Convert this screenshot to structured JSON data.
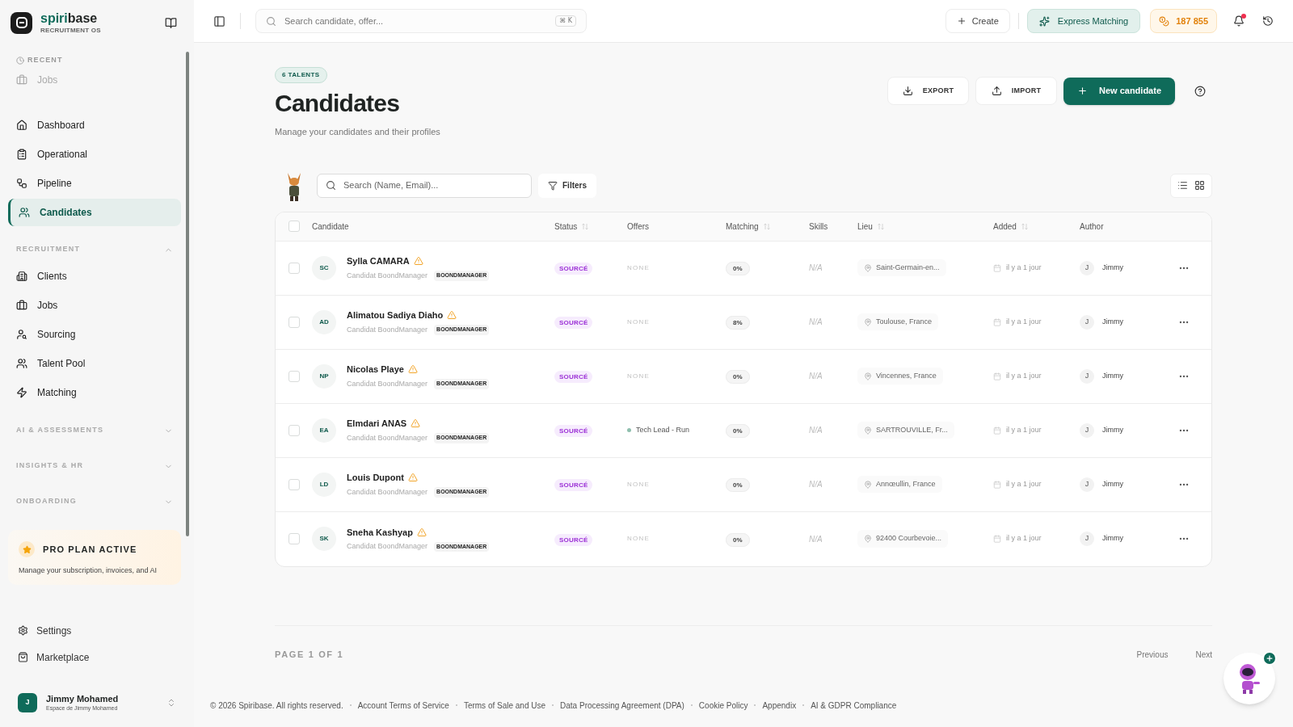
{
  "brand": {
    "name_accent": "spiri",
    "name": "base",
    "tagline": "RECRUITMENT OS"
  },
  "sidebar": {
    "recent": {
      "label": "RECENT",
      "items": [
        {
          "label": "Jobs"
        }
      ]
    },
    "nav": [
      {
        "label": "Dashboard",
        "selected": false
      },
      {
        "label": "Operational",
        "selected": false
      },
      {
        "label": "Pipeline",
        "selected": false
      },
      {
        "label": "Candidates",
        "selected": true
      }
    ],
    "sections": [
      {
        "label": "RECRUITMENT",
        "expanded": true,
        "items": [
          {
            "label": "Clients",
            "selected": false
          },
          {
            "label": "Jobs",
            "selected": false
          },
          {
            "label": "Sourcing",
            "selected": false
          },
          {
            "label": "Talent Pool",
            "selected": false
          },
          {
            "label": "Matching",
            "selected": false
          }
        ]
      },
      {
        "label": "AI & ASSESSMENTS",
        "expanded": false
      },
      {
        "label": "INSIGHTS & HR",
        "expanded": false
      },
      {
        "label": "ONBOARDING",
        "expanded": false
      }
    ],
    "plan": {
      "title": "PRO PLAN ACTIVE",
      "text": "Manage your subscription, invoices, and AI"
    },
    "bottom": [
      {
        "label": "Settings"
      },
      {
        "label": "Marketplace"
      }
    ],
    "user": {
      "initial": "J",
      "name": "Jimmy Mohamed",
      "workspace": "Espace de Jimmy Mohamed"
    }
  },
  "topbar": {
    "search_placeholder": "Search candidate, offer...",
    "shortcut": "⌘ K",
    "create": "Create",
    "express": "Express Matching",
    "credits": "187 855",
    "unread_notifications": true
  },
  "page": {
    "badge": "6 TALENTS",
    "title": "Candidates",
    "subtitle": "Manage your candidates and their profiles",
    "export": "EXPORT",
    "import": "IMPORT",
    "new": "New candidate",
    "search_placeholder": "Search (Name, Email)...",
    "filters": "Filters"
  },
  "table": {
    "all_checked": false,
    "columns": [
      {
        "label": "Candidate",
        "sortable": false
      },
      {
        "label": "Status",
        "sortable": true
      },
      {
        "label": "Offers",
        "sortable": false
      },
      {
        "label": "Matching",
        "sortable": true
      },
      {
        "label": "Skills",
        "sortable": false
      },
      {
        "label": "Lieu",
        "sortable": true
      },
      {
        "label": "Added",
        "sortable": true
      },
      {
        "label": "Author",
        "sortable": false
      }
    ],
    "rows": [
      {
        "checked": false,
        "initials": "SC",
        "name": "Sylla CAMARA",
        "warning": true,
        "source": "Candidat BoondManager",
        "tag": "BOONDMANAGER",
        "status": "SOURCÉ",
        "offer": {
          "kind": "none",
          "label": "NONE"
        },
        "matching": "0%",
        "skills": "N/A",
        "location": "Saint-Germain-en...",
        "added": "il y a 1 jour",
        "author_initial": "J",
        "author": "Jimmy"
      },
      {
        "checked": false,
        "initials": "AD",
        "name": "Alimatou Sadiya Diaho",
        "warning": true,
        "source": "Candidat BoondManager",
        "tag": "BOONDMANAGER",
        "status": "SOURCÉ",
        "offer": {
          "kind": "none",
          "label": "NONE"
        },
        "matching": "8%",
        "skills": "N/A",
        "location": "Toulouse, France",
        "added": "il y a 1 jour",
        "author_initial": "J",
        "author": "Jimmy"
      },
      {
        "checked": false,
        "initials": "NP",
        "name": "Nicolas Playe",
        "warning": true,
        "source": "Candidat BoondManager",
        "tag": "BOONDMANAGER",
        "status": "SOURCÉ",
        "offer": {
          "kind": "none",
          "label": "NONE"
        },
        "matching": "0%",
        "skills": "N/A",
        "location": "Vincennes, France",
        "added": "il y a 1 jour",
        "author_initial": "J",
        "author": "Jimmy"
      },
      {
        "checked": false,
        "initials": "EA",
        "name": "Elmdari ANAS",
        "warning": true,
        "source": "Candidat BoondManager",
        "tag": "BOONDMANAGER",
        "status": "SOURCÉ",
        "offer": {
          "kind": "offer",
          "label": "Tech Lead - Run",
          "color": "#8fbfae"
        },
        "matching": "0%",
        "skills": "N/A",
        "location": "SARTROUVILLE, Fr...",
        "added": "il y a 1 jour",
        "author_initial": "J",
        "author": "Jimmy"
      },
      {
        "checked": false,
        "initials": "LD",
        "name": "Louis Dupont",
        "warning": true,
        "source": "Candidat BoondManager",
        "tag": "BOONDMANAGER",
        "status": "SOURCÉ",
        "offer": {
          "kind": "none",
          "label": "NONE"
        },
        "matching": "0%",
        "skills": "N/A",
        "location": "Annœullin, France",
        "added": "il y a 1 jour",
        "author_initial": "J",
        "author": "Jimmy"
      },
      {
        "checked": false,
        "initials": "SK",
        "name": "Sneha Kashyap",
        "warning": true,
        "source": "Candidat BoondManager",
        "tag": "BOONDMANAGER",
        "status": "SOURCÉ",
        "offer": {
          "kind": "none",
          "label": "NONE"
        },
        "matching": "0%",
        "skills": "N/A",
        "location": "92400 Courbevoie...",
        "added": "il y a 1 jour",
        "author_initial": "J",
        "author": "Jimmy"
      }
    ]
  },
  "pagination": {
    "label": "PAGE 1 OF 1",
    "previous": "Previous",
    "next": "Next"
  },
  "footer": {
    "copyright": "© 2026 Spiribase. All rights reserved.",
    "links": [
      "Account Terms of Service",
      "Terms of Sale and Use",
      "Data Processing Agreement (DPA)",
      "Cookie Policy",
      "Appendix",
      "AI & GDPR Compliance"
    ]
  }
}
